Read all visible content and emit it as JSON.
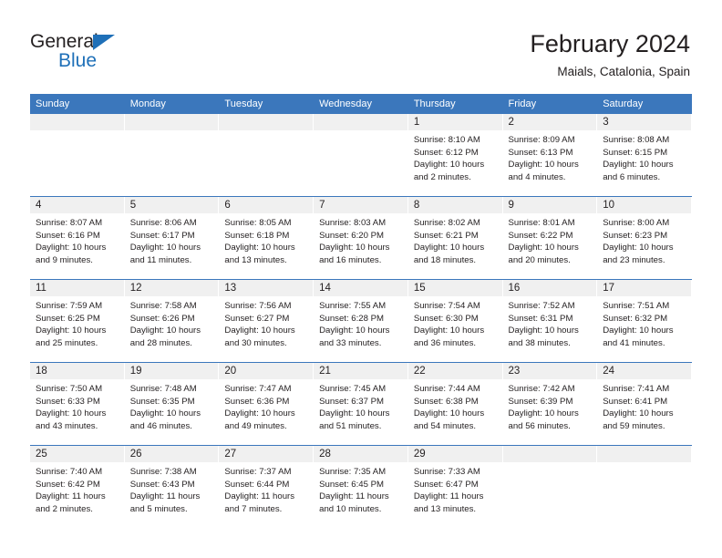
{
  "brand": {
    "word_one": "General",
    "word_two": "Blue",
    "triangle_icon": "blue-triangle-icon",
    "blue": "#1f70b8"
  },
  "header": {
    "title": "February 2024",
    "subtitle": "Maials, Catalonia, Spain"
  },
  "theme": {
    "header_bar": "#3b77bc",
    "day_band": "#f0f0f0",
    "text": "#231f20"
  },
  "weekday_headers": [
    "Sunday",
    "Monday",
    "Tuesday",
    "Wednesday",
    "Thursday",
    "Friday",
    "Saturday"
  ],
  "weeks": [
    [
      {
        "day": "",
        "sunrise": "",
        "sunset": "",
        "daylight": "",
        "empty": true
      },
      {
        "day": "",
        "sunrise": "",
        "sunset": "",
        "daylight": "",
        "empty": true
      },
      {
        "day": "",
        "sunrise": "",
        "sunset": "",
        "daylight": "",
        "empty": true
      },
      {
        "day": "",
        "sunrise": "",
        "sunset": "",
        "daylight": "",
        "empty": true
      },
      {
        "day": "1",
        "sunrise": "Sunrise: 8:10 AM",
        "sunset": "Sunset: 6:12 PM",
        "daylight": "Daylight: 10 hours and 2 minutes."
      },
      {
        "day": "2",
        "sunrise": "Sunrise: 8:09 AM",
        "sunset": "Sunset: 6:13 PM",
        "daylight": "Daylight: 10 hours and 4 minutes."
      },
      {
        "day": "3",
        "sunrise": "Sunrise: 8:08 AM",
        "sunset": "Sunset: 6:15 PM",
        "daylight": "Daylight: 10 hours and 6 minutes."
      }
    ],
    [
      {
        "day": "4",
        "sunrise": "Sunrise: 8:07 AM",
        "sunset": "Sunset: 6:16 PM",
        "daylight": "Daylight: 10 hours and 9 minutes."
      },
      {
        "day": "5",
        "sunrise": "Sunrise: 8:06 AM",
        "sunset": "Sunset: 6:17 PM",
        "daylight": "Daylight: 10 hours and 11 minutes."
      },
      {
        "day": "6",
        "sunrise": "Sunrise: 8:05 AM",
        "sunset": "Sunset: 6:18 PM",
        "daylight": "Daylight: 10 hours and 13 minutes."
      },
      {
        "day": "7",
        "sunrise": "Sunrise: 8:03 AM",
        "sunset": "Sunset: 6:20 PM",
        "daylight": "Daylight: 10 hours and 16 minutes."
      },
      {
        "day": "8",
        "sunrise": "Sunrise: 8:02 AM",
        "sunset": "Sunset: 6:21 PM",
        "daylight": "Daylight: 10 hours and 18 minutes."
      },
      {
        "day": "9",
        "sunrise": "Sunrise: 8:01 AM",
        "sunset": "Sunset: 6:22 PM",
        "daylight": "Daylight: 10 hours and 20 minutes."
      },
      {
        "day": "10",
        "sunrise": "Sunrise: 8:00 AM",
        "sunset": "Sunset: 6:23 PM",
        "daylight": "Daylight: 10 hours and 23 minutes."
      }
    ],
    [
      {
        "day": "11",
        "sunrise": "Sunrise: 7:59 AM",
        "sunset": "Sunset: 6:25 PM",
        "daylight": "Daylight: 10 hours and 25 minutes."
      },
      {
        "day": "12",
        "sunrise": "Sunrise: 7:58 AM",
        "sunset": "Sunset: 6:26 PM",
        "daylight": "Daylight: 10 hours and 28 minutes."
      },
      {
        "day": "13",
        "sunrise": "Sunrise: 7:56 AM",
        "sunset": "Sunset: 6:27 PM",
        "daylight": "Daylight: 10 hours and 30 minutes."
      },
      {
        "day": "14",
        "sunrise": "Sunrise: 7:55 AM",
        "sunset": "Sunset: 6:28 PM",
        "daylight": "Daylight: 10 hours and 33 minutes."
      },
      {
        "day": "15",
        "sunrise": "Sunrise: 7:54 AM",
        "sunset": "Sunset: 6:30 PM",
        "daylight": "Daylight: 10 hours and 36 minutes."
      },
      {
        "day": "16",
        "sunrise": "Sunrise: 7:52 AM",
        "sunset": "Sunset: 6:31 PM",
        "daylight": "Daylight: 10 hours and 38 minutes."
      },
      {
        "day": "17",
        "sunrise": "Sunrise: 7:51 AM",
        "sunset": "Sunset: 6:32 PM",
        "daylight": "Daylight: 10 hours and 41 minutes."
      }
    ],
    [
      {
        "day": "18",
        "sunrise": "Sunrise: 7:50 AM",
        "sunset": "Sunset: 6:33 PM",
        "daylight": "Daylight: 10 hours and 43 minutes."
      },
      {
        "day": "19",
        "sunrise": "Sunrise: 7:48 AM",
        "sunset": "Sunset: 6:35 PM",
        "daylight": "Daylight: 10 hours and 46 minutes."
      },
      {
        "day": "20",
        "sunrise": "Sunrise: 7:47 AM",
        "sunset": "Sunset: 6:36 PM",
        "daylight": "Daylight: 10 hours and 49 minutes."
      },
      {
        "day": "21",
        "sunrise": "Sunrise: 7:45 AM",
        "sunset": "Sunset: 6:37 PM",
        "daylight": "Daylight: 10 hours and 51 minutes."
      },
      {
        "day": "22",
        "sunrise": "Sunrise: 7:44 AM",
        "sunset": "Sunset: 6:38 PM",
        "daylight": "Daylight: 10 hours and 54 minutes."
      },
      {
        "day": "23",
        "sunrise": "Sunrise: 7:42 AM",
        "sunset": "Sunset: 6:39 PM",
        "daylight": "Daylight: 10 hours and 56 minutes."
      },
      {
        "day": "24",
        "sunrise": "Sunrise: 7:41 AM",
        "sunset": "Sunset: 6:41 PM",
        "daylight": "Daylight: 10 hours and 59 minutes."
      }
    ],
    [
      {
        "day": "25",
        "sunrise": "Sunrise: 7:40 AM",
        "sunset": "Sunset: 6:42 PM",
        "daylight": "Daylight: 11 hours and 2 minutes."
      },
      {
        "day": "26",
        "sunrise": "Sunrise: 7:38 AM",
        "sunset": "Sunset: 6:43 PM",
        "daylight": "Daylight: 11 hours and 5 minutes."
      },
      {
        "day": "27",
        "sunrise": "Sunrise: 7:37 AM",
        "sunset": "Sunset: 6:44 PM",
        "daylight": "Daylight: 11 hours and 7 minutes."
      },
      {
        "day": "28",
        "sunrise": "Sunrise: 7:35 AM",
        "sunset": "Sunset: 6:45 PM",
        "daylight": "Daylight: 11 hours and 10 minutes."
      },
      {
        "day": "29",
        "sunrise": "Sunrise: 7:33 AM",
        "sunset": "Sunset: 6:47 PM",
        "daylight": "Daylight: 11 hours and 13 minutes."
      },
      {
        "day": "",
        "sunrise": "",
        "sunset": "",
        "daylight": "",
        "empty": true
      },
      {
        "day": "",
        "sunrise": "",
        "sunset": "",
        "daylight": "",
        "empty": true
      }
    ]
  ]
}
